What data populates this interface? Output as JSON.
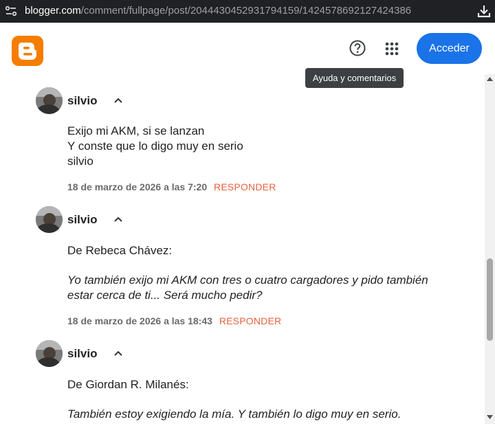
{
  "browser": {
    "url_domain": "blogger.com",
    "url_path": "/comment/fullpage/post/2044430452931794159/1424578692127424386"
  },
  "header": {
    "signin_label": "Acceder",
    "help_tooltip": "Ayuda y comentarios"
  },
  "comments": [
    {
      "author": "silvio",
      "lines": [
        "Exijo mi AKM, si se lanzan",
        "Y conste que lo digo muy en serio",
        "silvio"
      ],
      "quote_lines": [],
      "date": "18 de marzo de 2026 a las 7:20",
      "reply_label": "RESPONDER"
    },
    {
      "author": "silvio",
      "lines": [
        "De Rebeca Chávez:"
      ],
      "quote_lines": [
        "Yo también exijo mi AKM con tres o cuatro cargadores y pido también",
        "estar cerca de ti... Será mucho pedir?"
      ],
      "date": "18 de marzo de 2026 a las 18:43",
      "reply_label": "RESPONDER"
    },
    {
      "author": "silvio",
      "lines": [
        "De Giordan R. Milanés:"
      ],
      "quote_lines": [
        "También estoy exigiendo la mía. Y también lo digo muy en serio."
      ],
      "date": "",
      "reply_label": ""
    }
  ],
  "icons": {
    "site": "site-settings-icon",
    "download": "download-icon",
    "help": "help-icon",
    "apps": "apps-grid-icon",
    "collapse": "chevron-up-icon"
  },
  "colors": {
    "brand_orange": "#f57d00",
    "signin_blue": "#1a73e8",
    "reply_orange": "#e8623d"
  }
}
